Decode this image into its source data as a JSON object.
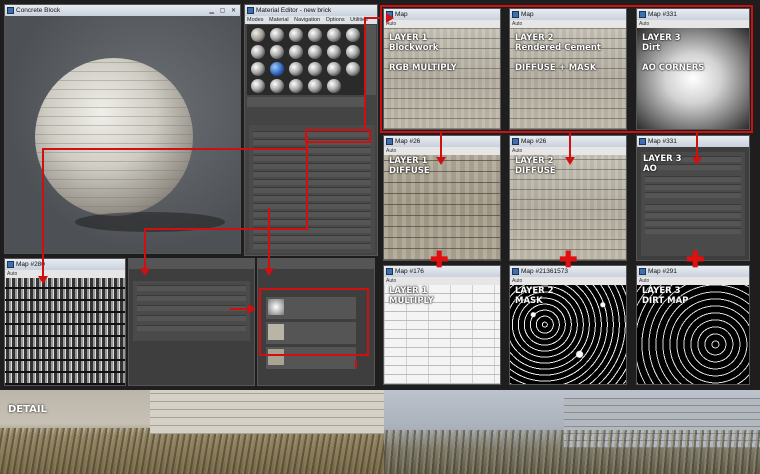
{
  "render_window": {
    "title": "Concrete Block"
  },
  "material_editor": {
    "title": "Material Editor - new brick",
    "menu": [
      "Modes",
      "Material",
      "Navigation",
      "Options",
      "Utilities"
    ]
  },
  "top_row": [
    {
      "title": "Map",
      "tab": "Auto",
      "line1": "LAYER 1",
      "line2": "Blockwork",
      "line3": "RGB MULTIPLY"
    },
    {
      "title": "Map",
      "tab": "Auto",
      "line1": "LAYER 2",
      "line2": "Rendered Cement",
      "line3": "DIFFUSE + MASK"
    },
    {
      "title": "Map #331",
      "tab": "Auto",
      "line1": "LAYER 3",
      "line2": "Dirt",
      "line3": "AO CORNERS"
    }
  ],
  "mid_row": [
    {
      "title": "Map #26",
      "tab": "Auto",
      "line1": "LAYER 1",
      "line2": "DIFFUSE"
    },
    {
      "title": "Map #26",
      "tab": "Auto",
      "line1": "LAYER 2",
      "line2": "DIFFUSE"
    },
    {
      "title": "Map #331",
      "tab": "Auto",
      "line1": "LAYER 3",
      "line2": "AO"
    }
  ],
  "bottom_row": [
    {
      "title": "Map #176",
      "tab": "Auto",
      "line1": "LAYER 1",
      "line2": "MULTIPLY"
    },
    {
      "title": "Map #21361573",
      "tab": "Auto",
      "line1": "LAYER 2",
      "line2": "MASK"
    },
    {
      "title": "Map #291",
      "tab": "Auto",
      "line1": "LAYER 3",
      "line2": "DIRT MAP"
    }
  ],
  "small_map_window": {
    "title": "Map #280",
    "tab": "Auto"
  },
  "detail": {
    "label": "DETAIL"
  },
  "colors": {
    "accent_red": "#d01010",
    "panel": "#444444",
    "titlebar": "#d8dee6"
  }
}
